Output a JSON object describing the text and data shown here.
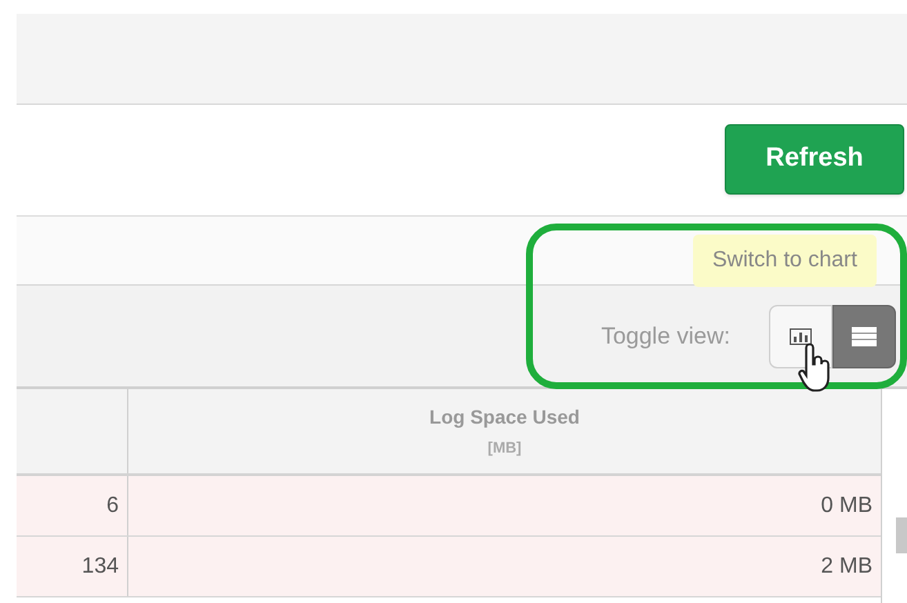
{
  "refresh_button": {
    "label": "Refresh"
  },
  "toggle_view": {
    "label": "Toggle view:",
    "tooltip": "Switch to chart",
    "options": [
      {
        "kind": "chart",
        "selected": false
      },
      {
        "kind": "table",
        "selected": true
      }
    ]
  },
  "table": {
    "columns": [
      {},
      {
        "title": "Log Space Used",
        "unit": "[MB]"
      }
    ],
    "rows": [
      {
        "cells": [
          "6",
          "0 MB"
        ]
      },
      {
        "cells": [
          "134",
          "2 MB"
        ]
      }
    ]
  }
}
